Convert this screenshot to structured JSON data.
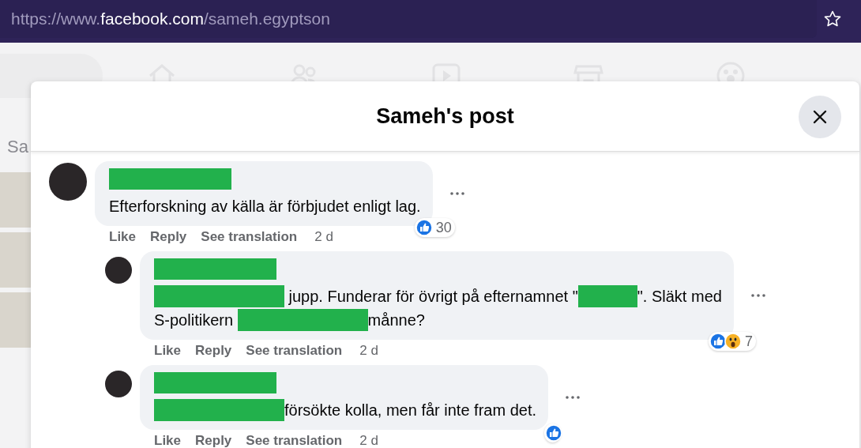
{
  "browser": {
    "url_parts": [
      {
        "text": "https://www.",
        "strong": false
      },
      {
        "text": "facebook.com",
        "strong": true
      },
      {
        "text": "/sameh.egyptson",
        "strong": false
      }
    ]
  },
  "background": {
    "partial_text": "Sa"
  },
  "dialog": {
    "title": "Sameh's post"
  },
  "comments": [
    {
      "reply": false,
      "lines": [
        [
          {
            "kind": "text",
            "text": "Efterforskning av källa är förbjudet enligt lag."
          }
        ]
      ],
      "reactions": [
        {
          "kind": "like"
        }
      ],
      "count": "30",
      "actions": [
        "Like",
        "Reply",
        "See translation"
      ],
      "time": "2 d"
    },
    {
      "reply": true,
      "lines": [
        [
          {
            "kind": "redaction"
          },
          {
            "kind": "text",
            "text": " jupp. Funderar för övrigt på efternamnet \""
          },
          {
            "kind": "blank"
          },
          {
            "kind": "text",
            "text": "\". Släkt med"
          }
        ],
        [
          {
            "kind": "text",
            "text": "S-politikern "
          },
          {
            "kind": "redaction"
          },
          {
            "kind": "text",
            "text": "månne?"
          }
        ]
      ],
      "reactions": [
        {
          "kind": "like"
        },
        {
          "kind": "wow"
        }
      ],
      "count": "7",
      "actions": [
        "Like",
        "Reply",
        "See translation"
      ],
      "time": "2 d"
    },
    {
      "reply": true,
      "lines": [
        [
          {
            "kind": "redaction"
          },
          {
            "kind": "text",
            "text": "försökte kolla, men får inte fram det."
          }
        ]
      ],
      "reactions": [
        {
          "kind": "like"
        }
      ],
      "actions": [
        "Like",
        "Reply",
        "See translation"
      ],
      "time": "2 d"
    }
  ]
}
